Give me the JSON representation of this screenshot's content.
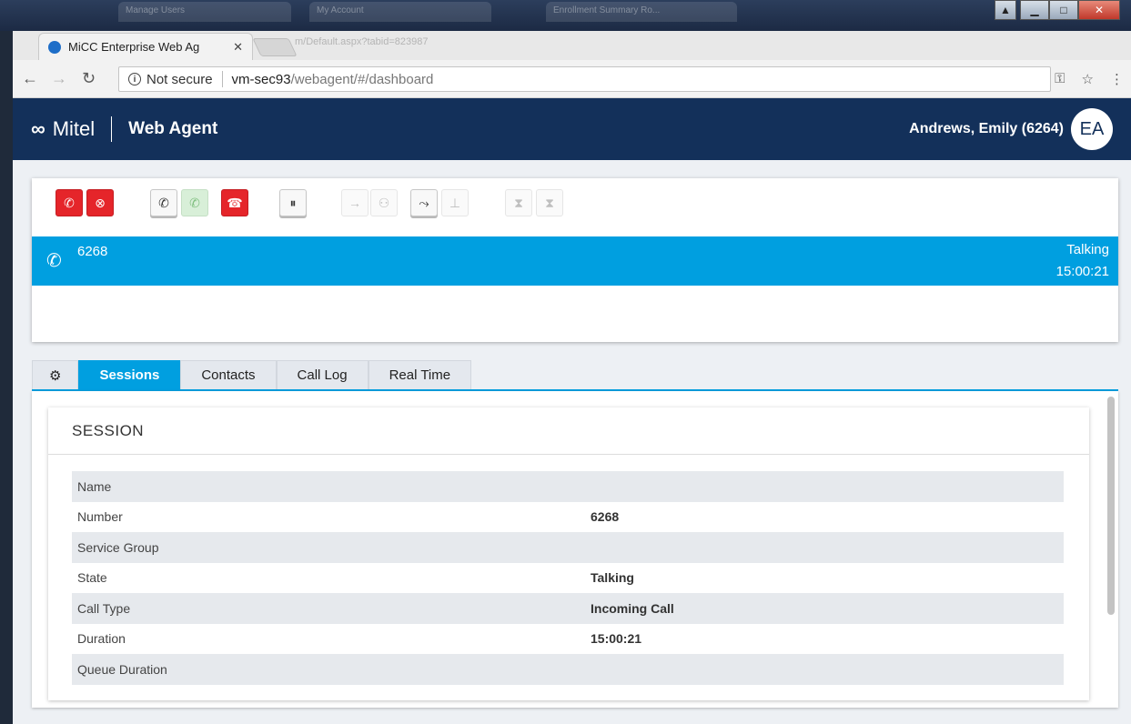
{
  "window": {
    "ghost_tabs": [
      "Manage Users",
      "My Account",
      "Enrollment Summary Ro..."
    ],
    "ghost_url": "m/Default.aspx?tabid=823987"
  },
  "browser": {
    "tab_title": "MiCC Enterprise Web Ag",
    "security_label": "Not secure",
    "url_host": "vm-sec93",
    "url_path": "/webagent/#/dashboard"
  },
  "header": {
    "logo": "Mitel",
    "product": "Web Agent",
    "user": "Andrews, Emily (6264)",
    "avatar_initials": "EA"
  },
  "call": {
    "number": "6268",
    "state": "Talking",
    "duration": "15:00:21"
  },
  "tabs": [
    {
      "label": "Sessions",
      "active": true
    },
    {
      "label": "Contacts",
      "active": false
    },
    {
      "label": "Call Log",
      "active": false
    },
    {
      "label": "Real Time",
      "active": false
    }
  ],
  "session": {
    "title": "SESSION",
    "rows": [
      {
        "label": "Name",
        "value": ""
      },
      {
        "label": "Number",
        "value": "6268"
      },
      {
        "label": "Service Group",
        "value": ""
      },
      {
        "label": "State",
        "value": "Talking"
      },
      {
        "label": "Call Type",
        "value": "Incoming Call"
      },
      {
        "label": "Duration",
        "value": "15:00:21"
      },
      {
        "label": "Queue Duration",
        "value": ""
      }
    ]
  },
  "colors": {
    "header_bg": "#13305a",
    "accent": "#009fe0",
    "danger": "#e5252a"
  }
}
